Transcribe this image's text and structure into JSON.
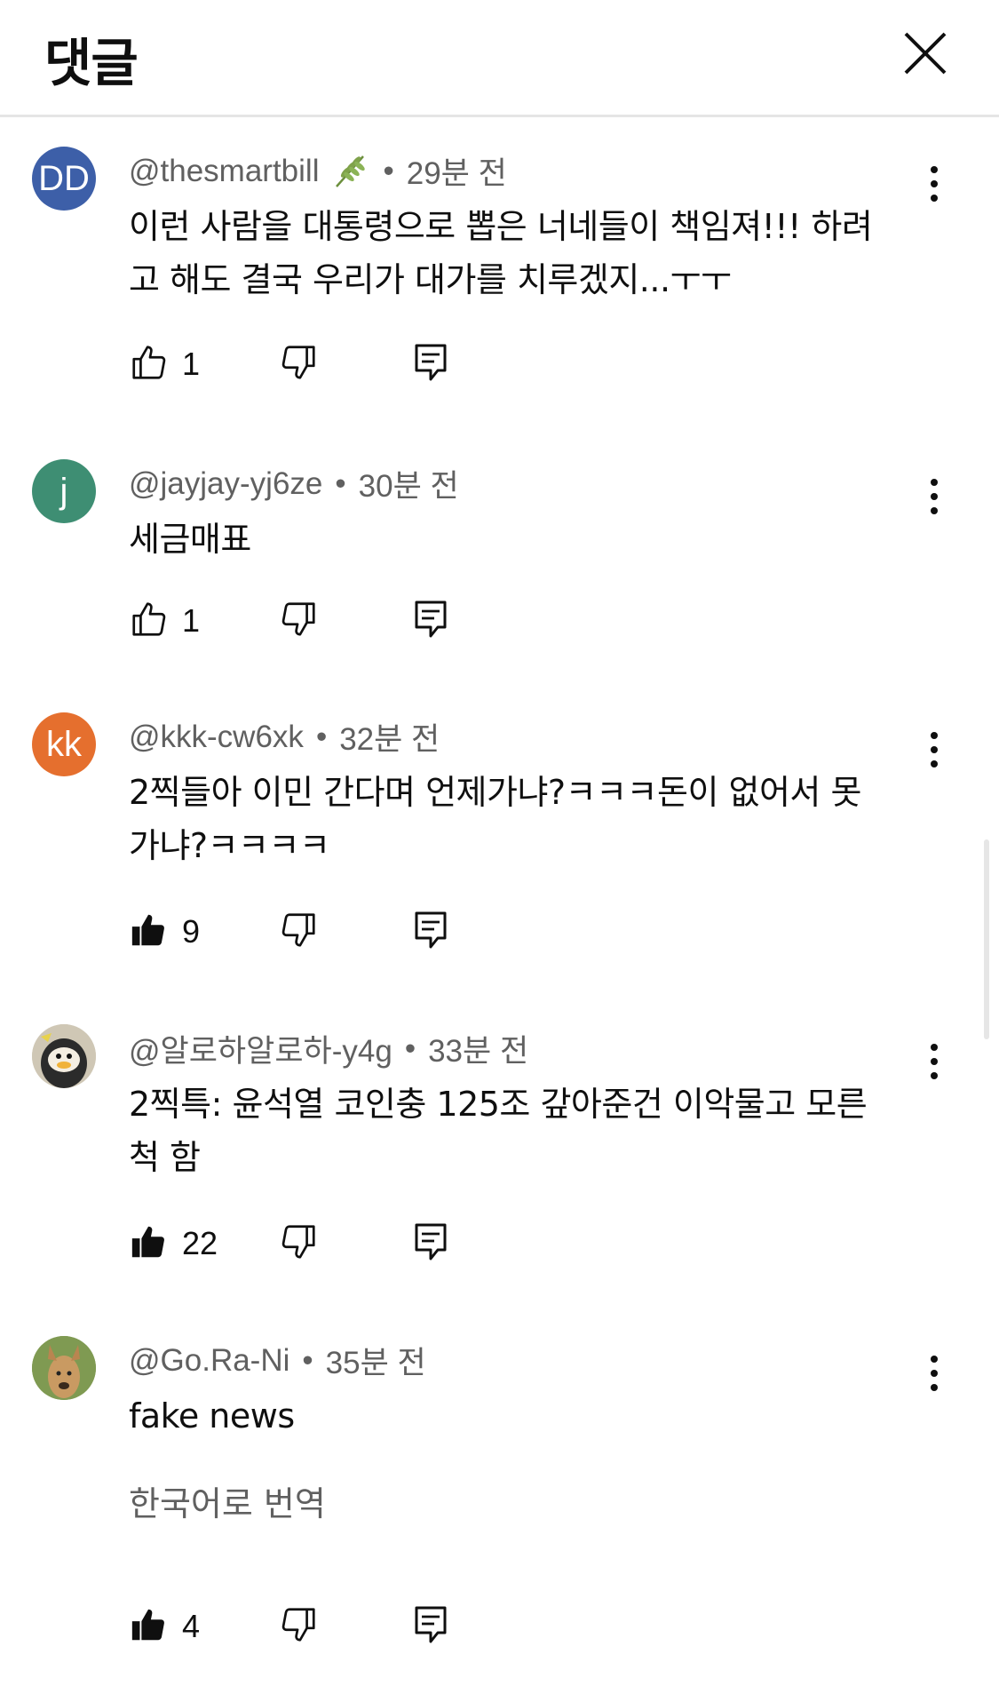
{
  "header": {
    "title": "댓글",
    "close_icon": "close-icon"
  },
  "comments": [
    {
      "avatar_text": "DD",
      "avatar_color": "#3d5fa8",
      "author": "@thesmartbill",
      "has_badge": true,
      "time": "29분 전",
      "text_lines": [
        "이런 사람을 대통령으로 뽑은 너네들이 책임져!!!  하려",
        "고 해도 결국 우리가 대가를 치루겠지...ㅜㅜ"
      ],
      "likes": "1",
      "liked": false
    },
    {
      "avatar_text": "j",
      "avatar_color": "#3e8e73",
      "author": "@jayjay-yj6ze",
      "has_badge": false,
      "time": "30분 전",
      "text_lines": [
        "세금매표"
      ],
      "likes": "1",
      "liked": false
    },
    {
      "avatar_text": "kk",
      "avatar_color": "#e56f2e",
      "author": "@kkk-cw6xk",
      "has_badge": false,
      "time": "32분 전",
      "text_lines": [
        "2찍들아 이민 간다며 언제가냐?ㅋㅋㅋ돈이 없어서 못",
        "가냐?ㅋㅋㅋㅋ"
      ],
      "likes": "9",
      "liked": true
    },
    {
      "avatar_text": "",
      "avatar_color": "#3a3a3a",
      "author": "@알로하알로하-y4g",
      "has_badge": false,
      "time": "33분 전",
      "text_lines": [
        "2찍특: 윤석열 코인충 125조 갚아준건 이악물고 모른",
        "척 함"
      ],
      "likes": "22",
      "liked": true
    },
    {
      "avatar_text": "",
      "avatar_color": "#8aa05a",
      "author": "@Go.Ra-Ni",
      "has_badge": false,
      "time": "35분 전",
      "text_lines": [
        "fake news"
      ],
      "translate_label": "한국어로 번역",
      "likes": "4",
      "liked": true
    }
  ],
  "icons": {
    "like": "thumb-up-icon",
    "dislike": "thumb-down-icon",
    "reply": "reply-icon",
    "more": "more-vert-icon",
    "badge": "wheat-leaf-icon"
  }
}
